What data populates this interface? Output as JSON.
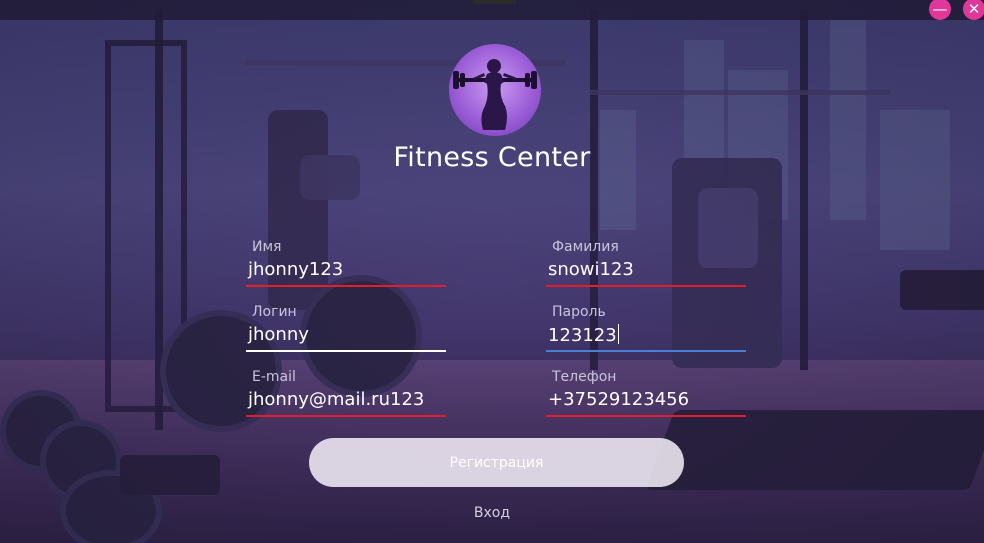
{
  "app": {
    "title": "Fitness Center"
  },
  "window_controls": {
    "minimize_icon": "minimize-icon",
    "close_icon": "close-icon",
    "minimize_glyph": "—",
    "close_glyph": "✕",
    "accent_color": "#e0379a"
  },
  "form": {
    "fields": [
      {
        "id": "first-name",
        "label": "Имя",
        "value": "jhonny123",
        "underline": "red"
      },
      {
        "id": "last-name",
        "label": "Фамилия",
        "value": "snowi123",
        "underline": "red"
      },
      {
        "id": "login",
        "label": "Логин",
        "value": "jhonny",
        "underline": "white"
      },
      {
        "id": "password",
        "label": "Пароль",
        "value": "123123",
        "underline": "blue",
        "focused": true
      },
      {
        "id": "email",
        "label": "E-mail",
        "value": "jhonny@mail.ru123",
        "underline": "red"
      },
      {
        "id": "phone",
        "label": "Телефон",
        "value": "+37529123456",
        "underline": "red"
      }
    ]
  },
  "actions": {
    "register_label": "Регистрация",
    "login_label": "Вход"
  },
  "colors": {
    "error_underline": "#e31e2a",
    "focus_underline": "#4a7fd8",
    "normal_underline": "#ffffff"
  }
}
